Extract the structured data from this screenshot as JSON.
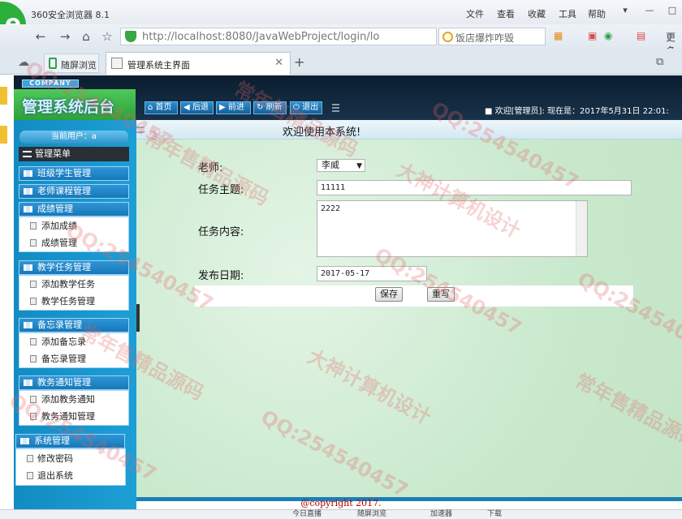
{
  "browser": {
    "app_title": "360安全浏览器 8.1",
    "menu": [
      "文件",
      "查看",
      "收藏",
      "工具",
      "帮助"
    ],
    "url": "http://localhost:8080/JavaWebProject/login/lo",
    "search_placeholder": "饭店爆炸咋毁",
    "toolbar_right": "更多",
    "tab_phone": "随屏浏览",
    "tab_active_title": "管理系统主界面"
  },
  "header": {
    "company": "COMPANY",
    "system_title": "管理系统后台",
    "buttons": [
      "首页",
      "后退",
      "前进",
      "刷新",
      "退出"
    ],
    "welcome": "欢迎[管理员]: 现在是：2017年5月31日 22:01:"
  },
  "sidebar": {
    "current_user": "当前用户：a",
    "menu_title": "管理菜单",
    "sections": [
      {
        "title": "班级学生管理",
        "items": []
      },
      {
        "title": "老师课程管理",
        "items": []
      },
      {
        "title": "成绩管理",
        "items": [
          "添加成绩",
          "成绩管理"
        ]
      },
      {
        "title": "教学任务管理",
        "items": [
          "添加教学任务",
          "教学任务管理"
        ]
      },
      {
        "title": "备忘录管理",
        "items": [
          "添加备忘录",
          "备忘录管理"
        ]
      },
      {
        "title": "教务通知管理",
        "items": [
          "添加教务通知",
          "教务通知管理"
        ]
      },
      {
        "title": "系统管理",
        "items": [
          "修改密码",
          "退出系统"
        ]
      }
    ]
  },
  "content": {
    "heading": "欢迎使用本系统!",
    "form": {
      "teacher_label": "老师:",
      "teacher_value": "李威",
      "subject_label": "任务主题:",
      "subject_value": "11111",
      "content_label": "任务内容:",
      "content_value": "2222",
      "date_label": "发布日期:",
      "date_value": "2017-05-17",
      "save": "保存",
      "reset": "重写"
    }
  },
  "footer": {
    "copyright": "@copyright 2017."
  },
  "statusbar": [
    "今日直播",
    "随屏浏览",
    "加速器",
    "下载"
  ],
  "watermark": {
    "text": "QQ:254540457",
    "text2": "大神计算机设计",
    "text3": "常年售精品源码",
    "color": "#e46363"
  }
}
